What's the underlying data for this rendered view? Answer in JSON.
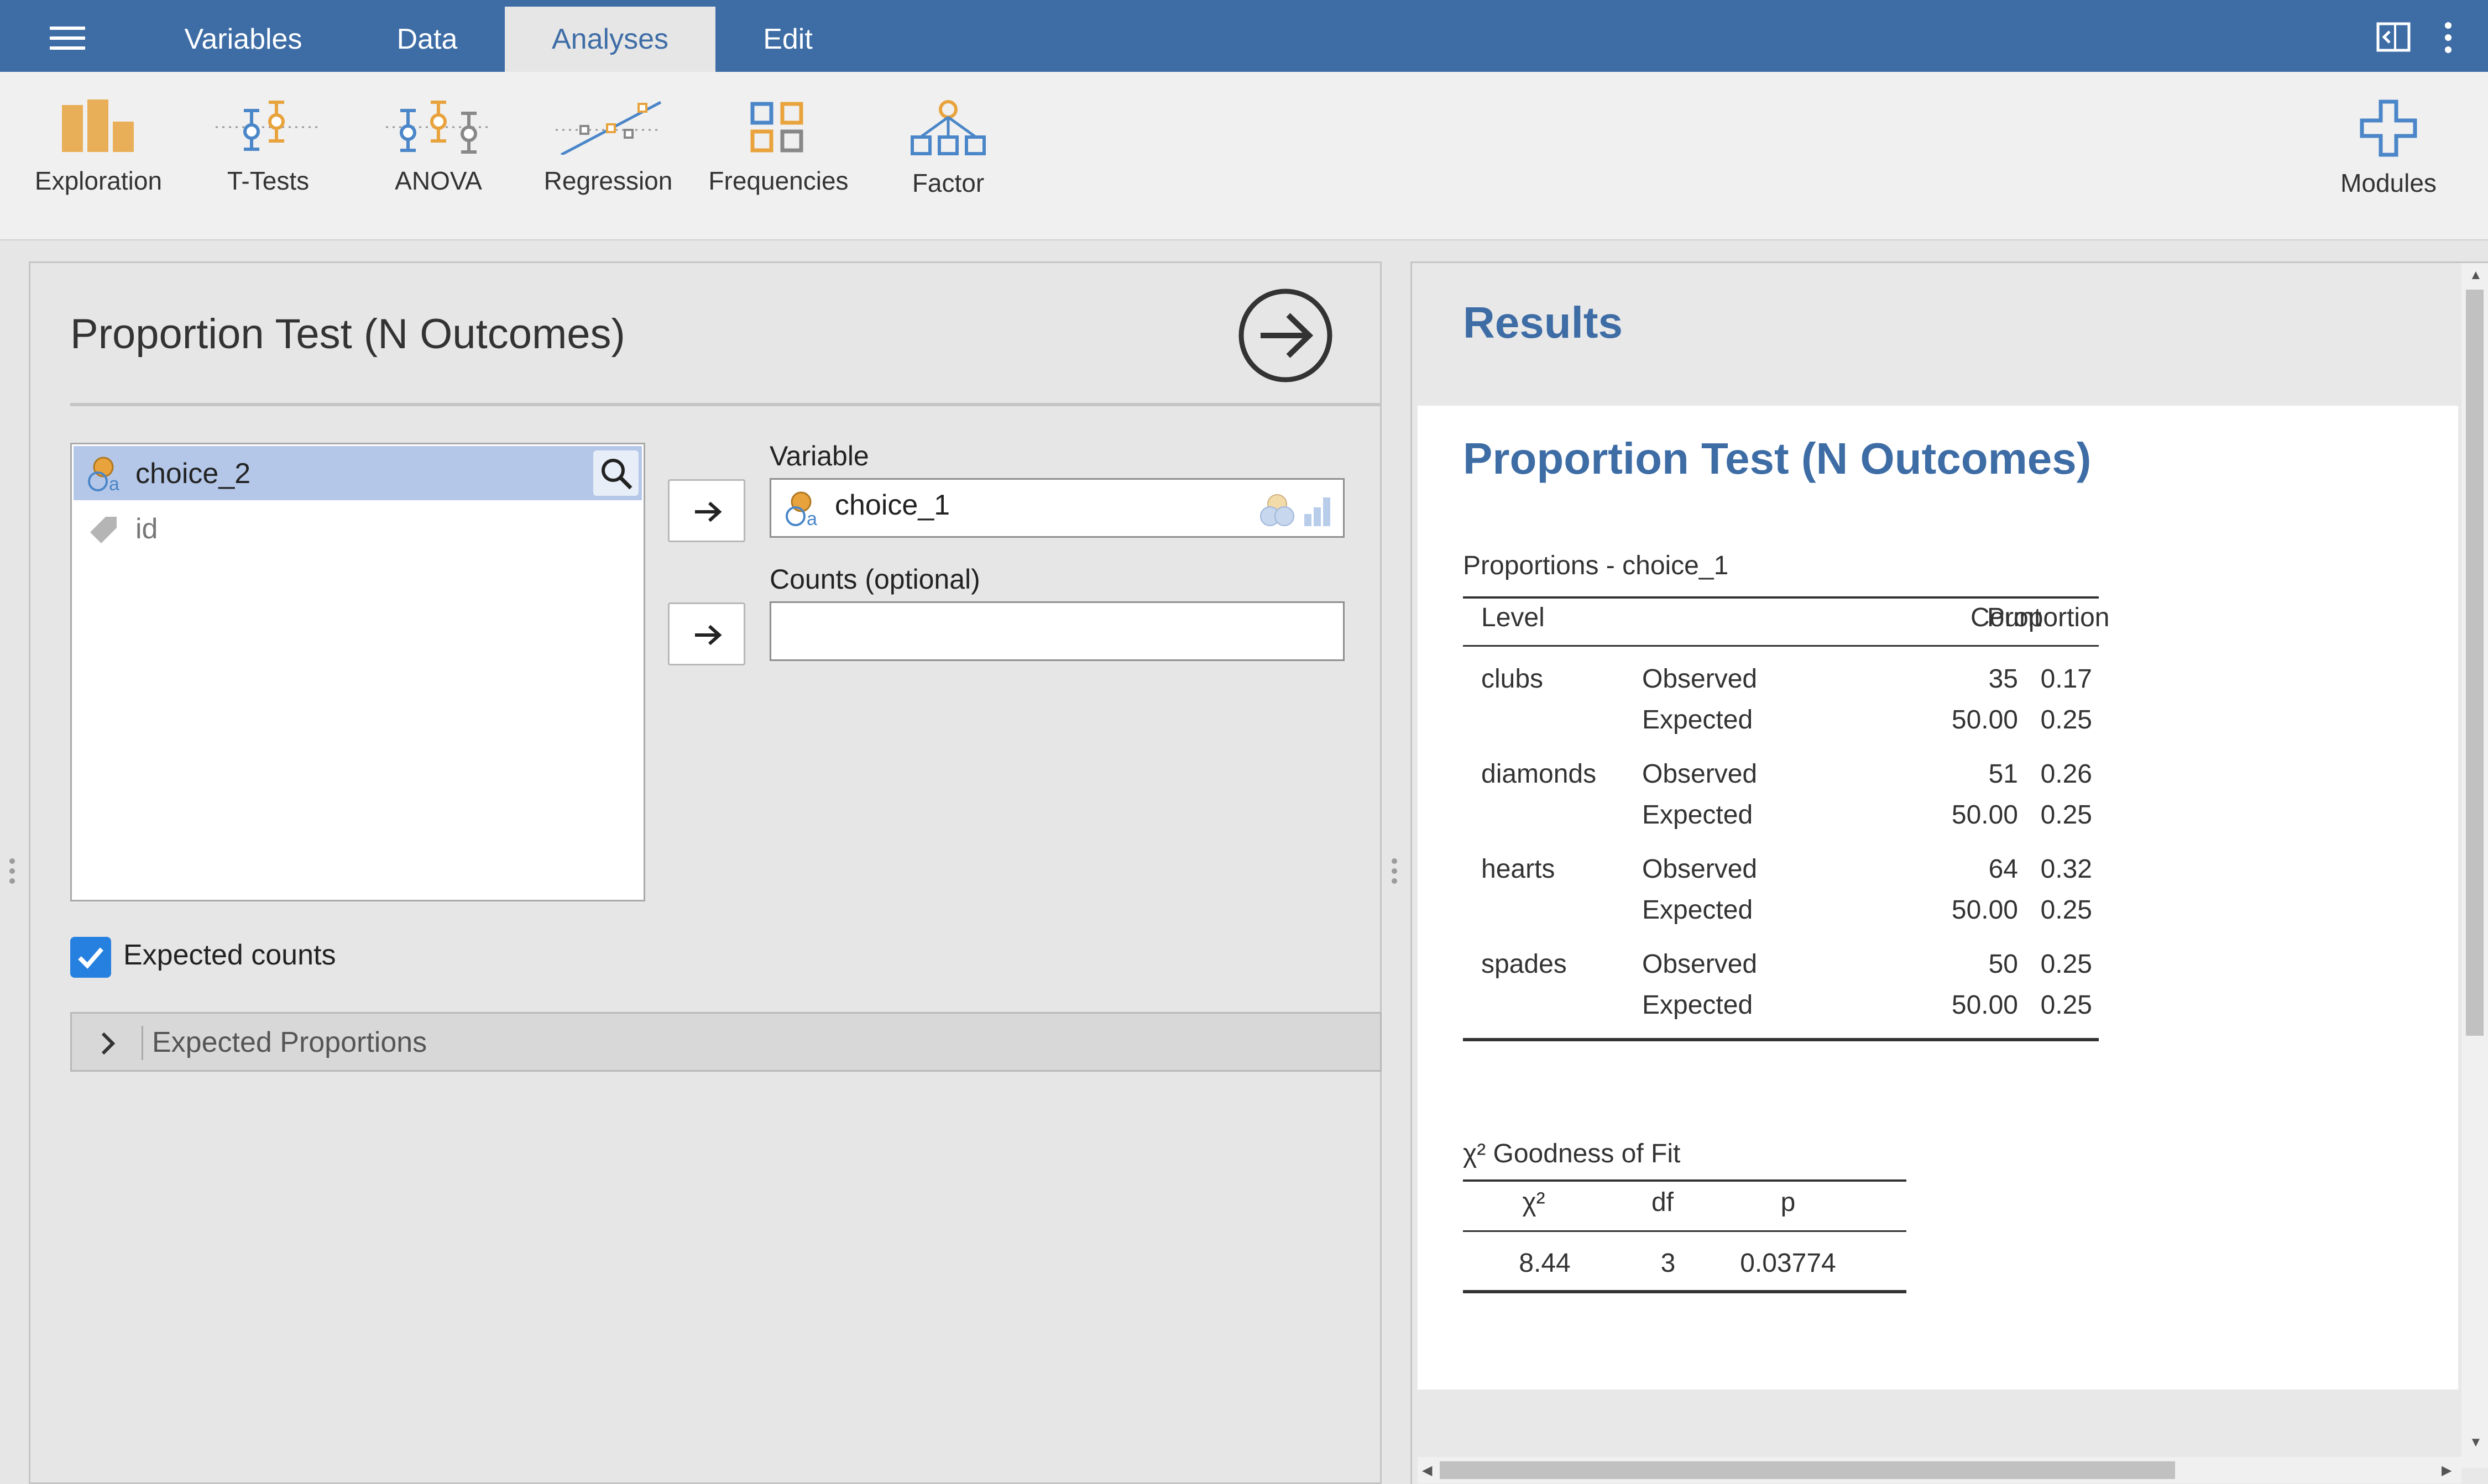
{
  "menu": {
    "tabs": [
      "Variables",
      "Data",
      "Analyses",
      "Edit"
    ],
    "active_tab": "Analyses"
  },
  "ribbon": {
    "items": [
      "Exploration",
      "T-Tests",
      "ANOVA",
      "Regression",
      "Frequencies",
      "Factor"
    ],
    "modules_label": "Modules"
  },
  "options": {
    "title": "Proportion Test (N Outcomes)",
    "variables": [
      {
        "name": "choice_2",
        "icon": "nominal-icon",
        "selected": true
      },
      {
        "name": "id",
        "icon": "id-icon",
        "selected": false
      }
    ],
    "variable_label": "Variable",
    "variable_value": "choice_1",
    "counts_label": "Counts (optional)",
    "counts_value": "",
    "expected_counts_label": "Expected counts",
    "expected_counts_checked": true,
    "expected_proportions_label": "Expected Proportions"
  },
  "results": {
    "header": "Results",
    "title": "Proportion Test (N Outcomes)",
    "proportions_table": {
      "title": "Proportions - choice_1",
      "columns": [
        "Level",
        "Count",
        "Proportion"
      ],
      "rows": [
        {
          "level": "clubs",
          "type": "Observed",
          "count": "35",
          "proportion": "0.17"
        },
        {
          "level": "",
          "type": "Expected",
          "count": "50.00",
          "proportion": "0.25"
        },
        {
          "level": "diamonds",
          "type": "Observed",
          "count": "51",
          "proportion": "0.26"
        },
        {
          "level": "",
          "type": "Expected",
          "count": "50.00",
          "proportion": "0.25"
        },
        {
          "level": "hearts",
          "type": "Observed",
          "count": "64",
          "proportion": "0.32"
        },
        {
          "level": "",
          "type": "Expected",
          "count": "50.00",
          "proportion": "0.25"
        },
        {
          "level": "spades",
          "type": "Observed",
          "count": "50",
          "proportion": "0.25"
        },
        {
          "level": "",
          "type": "Expected",
          "count": "50.00",
          "proportion": "0.25"
        }
      ]
    },
    "gof_table": {
      "title": "χ² Goodness of Fit",
      "columns": [
        "χ²",
        "df",
        "p"
      ],
      "row": [
        "8.44",
        "3",
        "0.03774"
      ]
    }
  },
  "colors": {
    "header_blue": "#3e6da6",
    "selection": "#b4c7e8",
    "checkbox": "#2680e0",
    "icon_orange": "#e8a33d",
    "icon_blue": "#4a86c8"
  }
}
